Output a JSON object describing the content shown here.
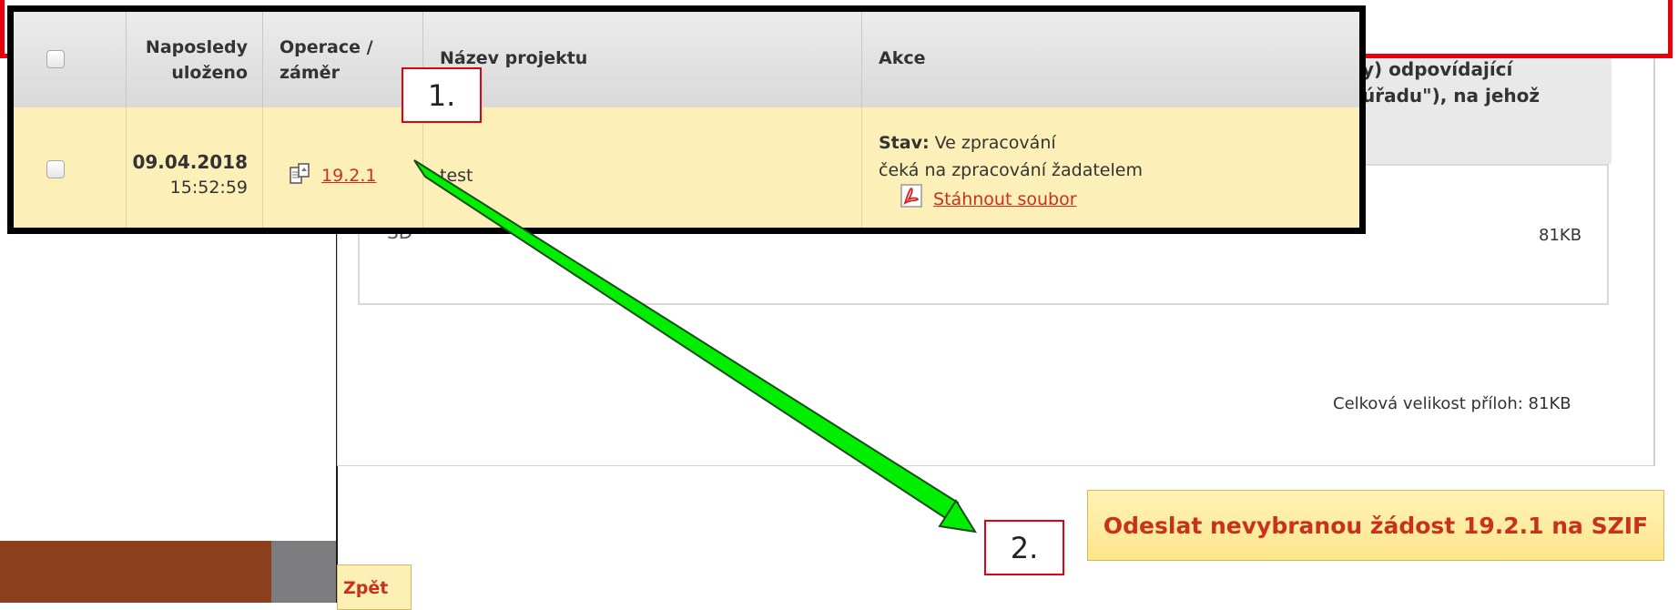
{
  "table": {
    "headers": {
      "saved_line1": "Naposledy",
      "saved_line2": "uloženo",
      "operation_line1": "Operace /",
      "operation_line2": "záměr",
      "project": "Název projektu",
      "actions": "Akce"
    },
    "row": {
      "date": "09.04.2018",
      "time": "15:52:59",
      "operation": "19.2.1",
      "project": "test",
      "status_label": "Stav:",
      "status_value": "Ve zpracování",
      "status_note": "čeká na zpracování žadatelem",
      "download": "Stáhnout soubor"
    }
  },
  "background": {
    "header_line1": "y) odpovídající",
    "header_line2": "úřadu\"), na jehož",
    "attachment_name": "SD",
    "attachment_size": "81KB",
    "total_size": "Celková velikost příloh: 81KB",
    "submit_button": "Odeslat nevybranou žádost 19.2.1 na SZIF",
    "back_button": "Zpět"
  },
  "annotations": {
    "step1": "1.",
    "step2": "2."
  },
  "colors": {
    "highlight_row": "#fcefb7",
    "link_red": "#c8321c",
    "arrow_green": "#00ee00",
    "frame_red": "#e8000b"
  },
  "icons": {
    "operation": "document-edit-icon",
    "download": "pdf-icon"
  }
}
